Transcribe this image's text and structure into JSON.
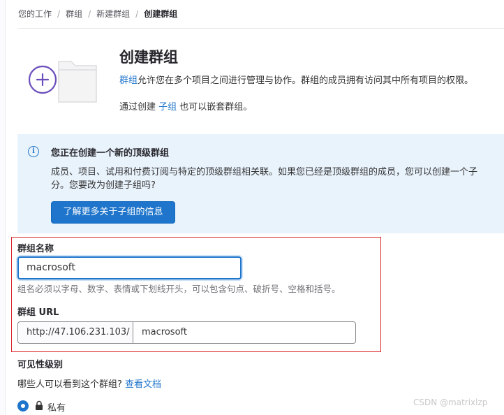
{
  "breadcrumb": {
    "items": [
      "您的工作",
      "群组",
      "新建群组"
    ],
    "current": "创建群组"
  },
  "header": {
    "title": "创建群组",
    "desc_link": "群组",
    "desc_rest": "允许您在多个项目之间进行管理与协作。群组的成员拥有访问其中所有项目的权限。",
    "subgroup_pre": "通过创建 ",
    "subgroup_link": "子组",
    "subgroup_post": " 也可以嵌套群组。"
  },
  "alert": {
    "icon": "info-icon",
    "title": "您正在创建一个新的顶级群组",
    "body_line1": "成员、项目、试用和付费订阅与特定的顶级群组相关联。如果您已经是顶级群组的成员，您可以创建一个子",
    "body_line2": "分。您要改为创建子组吗?",
    "button": "了解更多关于子组的信息"
  },
  "form": {
    "name_label": "群组名称",
    "name_value": "macrosoft",
    "name_help": "组名必须以字母、数字、表情或下划线开头，可以包含句点、破折号、空格和括号。",
    "url_label": "群组 URL",
    "url_prefix": "http://47.106.231.103/",
    "url_value": "macrosoft"
  },
  "visibility": {
    "label": "可见性级别",
    "question": "哪些人可以看到这个群组?",
    "docs_link": "查看文档",
    "options": [
      {
        "label": "私有",
        "selected": true,
        "icon": "lock-icon"
      }
    ]
  },
  "watermark": "CSDN @matrixlzp",
  "colors": {
    "accent": "#1f75cb",
    "alert_bg": "#e9f3fc",
    "highlight_box": "#d9252a"
  }
}
